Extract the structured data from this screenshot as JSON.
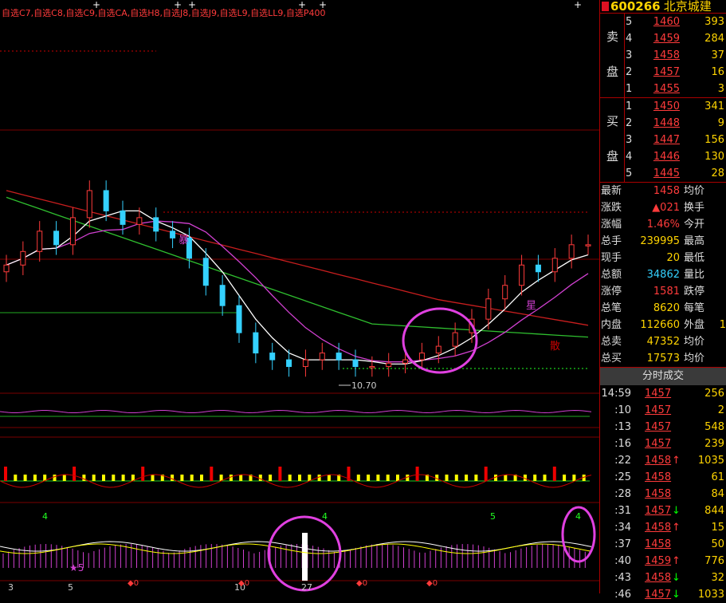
{
  "indicator_legend": "自选C7,自选C8,自选C9,自选CA,自选H8,自选J8,自选J9,自选L9,自选LL9,自选P400",
  "quote": {
    "code": "600266",
    "name": "北京城建"
  },
  "order_book": {
    "sell_label": [
      "卖",
      "盘"
    ],
    "buy_label": [
      "买",
      "盘"
    ],
    "sell": [
      {
        "level": "5",
        "price": "1460",
        "vol": "393"
      },
      {
        "level": "4",
        "price": "1459",
        "vol": "284"
      },
      {
        "level": "3",
        "price": "1458",
        "vol": "37"
      },
      {
        "level": "2",
        "price": "1457",
        "vol": "16"
      },
      {
        "level": "1",
        "price": "1455",
        "vol": "3"
      }
    ],
    "buy": [
      {
        "level": "1",
        "price": "1450",
        "vol": "341"
      },
      {
        "level": "2",
        "price": "1448",
        "vol": "9"
      },
      {
        "level": "3",
        "price": "1447",
        "vol": "156"
      },
      {
        "level": "4",
        "price": "1446",
        "vol": "130"
      },
      {
        "level": "5",
        "price": "1445",
        "vol": "28"
      }
    ]
  },
  "stats": [
    {
      "label": "最新",
      "value": "1458",
      "label2": "均价",
      "value2": ""
    },
    {
      "label": "涨跌",
      "value": "▲021",
      "label2": "换手",
      "value2": ""
    },
    {
      "label": "涨幅",
      "value": "1.46%",
      "label2": "今开",
      "value2": ""
    },
    {
      "label": "总手",
      "value": "239995",
      "label2": "最高",
      "value2": ""
    },
    {
      "label": "现手",
      "value": "20",
      "label2": "最低",
      "value2": ""
    },
    {
      "label": "总额",
      "value": "34862",
      "label2": "量比",
      "value2": ""
    },
    {
      "label": "涨停",
      "value": "1581",
      "label2": "跌停",
      "value2": ""
    },
    {
      "label": "总笔",
      "value": "8620",
      "label2": "每笔",
      "value2": ""
    },
    {
      "label": "内盘",
      "value": "112660",
      "label2": "外盘",
      "value2": "1"
    },
    {
      "label": "总卖",
      "value": "47352",
      "label2": "均价",
      "value2": ""
    },
    {
      "label": "总买",
      "value": "17573",
      "label2": "均价",
      "value2": ""
    }
  ],
  "ticks_title": "分时成交",
  "ticks": [
    {
      "time": "14:59",
      "price": "1457",
      "arrow": "",
      "vol": "256",
      "color": "#ff3b3b"
    },
    {
      "time": ":10",
      "price": "1457",
      "arrow": "",
      "vol": "2",
      "color": "#ff3b3b"
    },
    {
      "time": ":13",
      "price": "1457",
      "arrow": "",
      "vol": "548",
      "color": "#ff3b3b"
    },
    {
      "time": ":16",
      "price": "1457",
      "arrow": "",
      "vol": "239",
      "color": "#ff3b3b"
    },
    {
      "time": ":22",
      "price": "1458",
      "arrow": "↑",
      "vol": "1035",
      "color": "#ff3b3b"
    },
    {
      "time": ":25",
      "price": "1458",
      "arrow": "",
      "vol": "61",
      "color": "#ff3b3b"
    },
    {
      "time": ":28",
      "price": "1458",
      "arrow": "",
      "vol": "84",
      "color": "#ff3b3b"
    },
    {
      "time": ":31",
      "price": "1457",
      "arrow": "↓",
      "vol": "844",
      "color": "#ff3b3b"
    },
    {
      "time": ":34",
      "price": "1458",
      "arrow": "↑",
      "vol": "15",
      "color": "#ff3b3b"
    },
    {
      "time": ":37",
      "price": "1458",
      "arrow": "",
      "vol": "50",
      "color": "#ff3b3b"
    },
    {
      "time": ":40",
      "price": "1459",
      "arrow": "↑",
      "vol": "776",
      "color": "#ff3b3b"
    },
    {
      "time": ":43",
      "price": "1458",
      "arrow": "↓",
      "vol": "32",
      "color": "#ff3b3b"
    },
    {
      "time": ":46",
      "price": "1457",
      "arrow": "↓",
      "vol": "1033",
      "color": "#ff3b3b"
    }
  ],
  "chart_labels": {
    "low_price": "10.70",
    "bao": "暴",
    "xing": "星",
    "san": "散",
    "date_ticks": [
      "3",
      "5",
      "10",
      "27"
    ],
    "top_marks": [
      "4",
      "4",
      "5",
      "4"
    ],
    "star_mark": "★5",
    "diamond_zero": "◆0"
  },
  "chart_data": {
    "type": "candlestick",
    "note_colors": {
      "up": "#ff3b3b",
      "down": "#34d1ff",
      "ma_white": "#ffffff",
      "ma_magenta": "#d040d0",
      "ma_green": "#2fbf2f",
      "ma_red": "#c81e1e"
    },
    "closes_shape": [
      12.3,
      12.5,
      12.8,
      12.6,
      13.0,
      13.4,
      13.1,
      12.9,
      13.0,
      12.8,
      12.7,
      12.4,
      12.0,
      11.7,
      11.3,
      11.0,
      10.9,
      10.8,
      10.9,
      11.0,
      10.9,
      10.8,
      10.8,
      10.85,
      10.9,
      11.0,
      11.1,
      11.3,
      11.5,
      11.8,
      12.0,
      12.3,
      12.2,
      12.4,
      12.6,
      12.6
    ],
    "low_label_value": 10.7
  }
}
